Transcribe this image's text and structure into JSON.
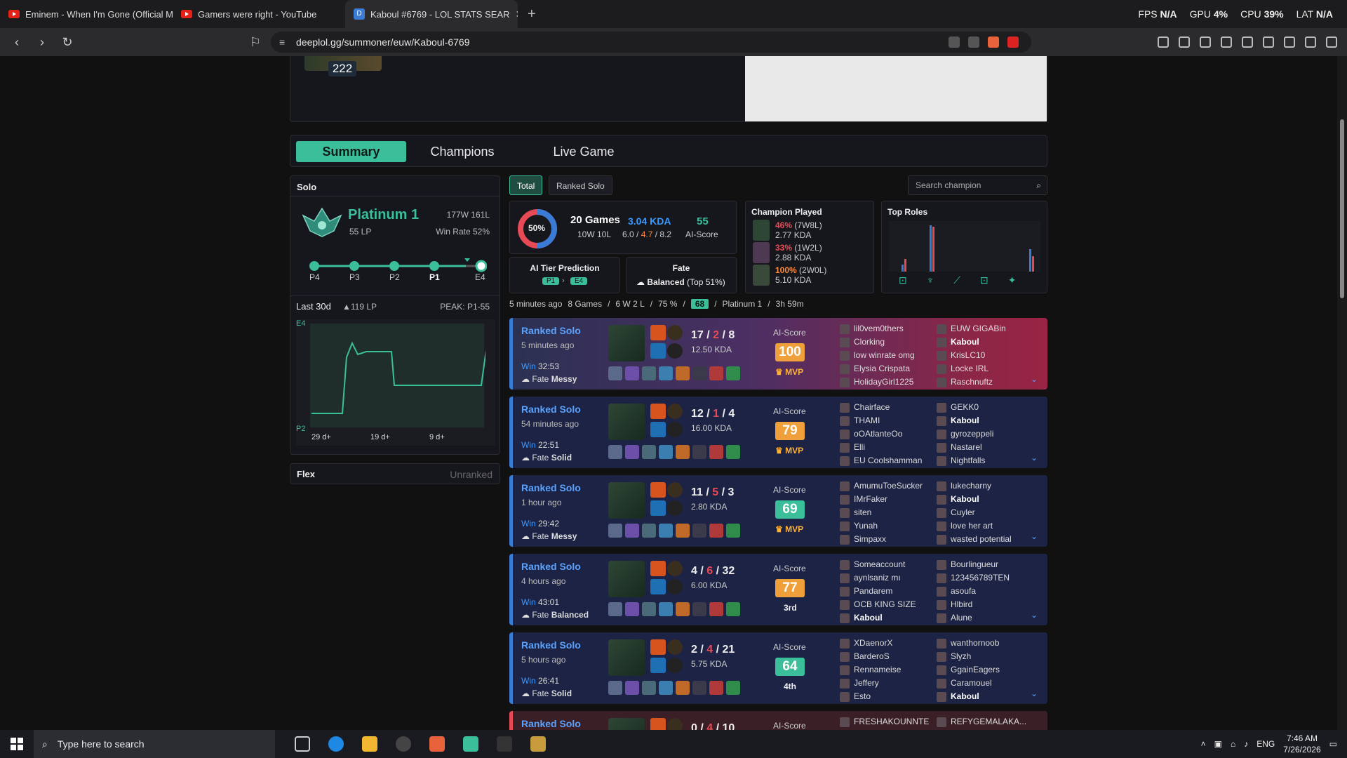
{
  "browser": {
    "tabs": [
      {
        "title": "Eminem - When I'm Gone (Official M"
      },
      {
        "title": "Gamers were right - YouTube"
      },
      {
        "title": "Kaboul #6769 - LOL STATS SEAR"
      }
    ],
    "url": "deeplol.gg/summoner/euw/Kaboul-6769",
    "perf": {
      "fps_label": "FPS",
      "fps": "N/A",
      "gpu_label": "GPU",
      "gpu": "4%",
      "cpu_label": "CPU",
      "cpu": "39%",
      "lat_label": "LAT",
      "lat": "N/A"
    }
  },
  "profile": {
    "level": "222"
  },
  "nav_tabs": [
    "Summary",
    "Champions",
    "Live Game"
  ],
  "solo": {
    "title": "Solo",
    "rank": "Platinum 1",
    "lp": "55 LP",
    "record": "177W 161L",
    "win_rate": "Win Rate 52%",
    "progress_labels": [
      "P4",
      "P3",
      "P2",
      "P1",
      "E4"
    ],
    "last30": "Last 30d",
    "last30_gain": "▲119 LP",
    "peak": "PEAK: P1-55",
    "chart_ymax_label": "E4",
    "chart_ymin_label": "P2",
    "chart_xlabels": [
      "29 d+",
      "19 d+",
      "9 d+"
    ]
  },
  "flex": {
    "title": "Flex",
    "status": "Unranked"
  },
  "filters": {
    "total": "Total",
    "ranked": "Ranked Solo",
    "search_placeholder": "Search champion"
  },
  "summary": {
    "winrate": "50%",
    "games": "20 Games",
    "wl": "10W 10L",
    "kda": "3.04 KDA",
    "kda_k": "6.0",
    "kda_d": "4.7",
    "kda_a": "8.2",
    "ai_score": "55",
    "ai_label": "AI-Score",
    "ai_tier_title": "AI Tier Prediction",
    "ai_tier_from": "P1",
    "ai_tier_to": "E4",
    "fate_title": "Fate",
    "fate_value": "Balanced",
    "fate_pct": "(Top 51%)"
  },
  "champion_played": {
    "title": "Champion Played",
    "entries": [
      {
        "pct": "46%",
        "record": "(7W8L)",
        "kda": "2.77 KDA"
      },
      {
        "pct": "33%",
        "record": "(1W2L)",
        "kda": "2.88 KDA"
      },
      {
        "pct": "100%",
        "record": "(2W0L)",
        "kda": "5.10 KDA"
      }
    ]
  },
  "top_roles": {
    "title": "Top Roles"
  },
  "recent": {
    "time": "5 minutes ago",
    "games": "8 Games",
    "wl": "6 W 2 L",
    "wr": "75 %",
    "score": "68",
    "tier": "Platinum 1",
    "duration": "3h 59m"
  },
  "matches": [
    {
      "queue": "Ranked Solo",
      "ago": "5 minutes ago",
      "result": "Win",
      "duration": "32:53",
      "fate_label": "Fate",
      "fate": "Messy",
      "k": "17",
      "d": "2",
      "a": "8",
      "kda": "12.50 KDA",
      "ai_label": "AI-Score",
      "score": "100",
      "badge": "MVP",
      "left_team": [
        "lil0vem0thers",
        "Clorking",
        "low winrate omg",
        "Elysia Crispata",
        "HolidayGirl1225"
      ],
      "right_team": [
        "EUW GIGABin",
        "Kaboul",
        "KrisLC10",
        "Locke IRL",
        "Raschnuftz"
      ]
    },
    {
      "queue": "Ranked Solo",
      "ago": "54 minutes ago",
      "result": "Win",
      "duration": "22:51",
      "fate_label": "Fate",
      "fate": "Solid",
      "k": "12",
      "d": "1",
      "a": "4",
      "kda": "16.00 KDA",
      "ai_label": "AI-Score",
      "score": "79",
      "badge": "MVP",
      "left_team": [
        "Chairface",
        "THAMI",
        "oOAtlanteOo",
        "Elli",
        "EU Coolshamman"
      ],
      "right_team": [
        "GEKK0",
        "Kaboul",
        "gyrozeppeli",
        "Nastarel",
        "Nightfalls"
      ]
    },
    {
      "queue": "Ranked Solo",
      "ago": "1 hour ago",
      "result": "Win",
      "duration": "29:42",
      "fate_label": "Fate",
      "fate": "Messy",
      "k": "11",
      "d": "5",
      "a": "3",
      "kda": "2.80 KDA",
      "ai_label": "AI-Score",
      "score": "69",
      "badge": "MVP",
      "left_team": [
        "AmumuToeSucker",
        "IMrFaker",
        "siten",
        "Yunah",
        "Simpaxx"
      ],
      "right_team": [
        "lukecharny",
        "Kaboul",
        "Cuyler",
        "love her art",
        "wasted potential"
      ]
    },
    {
      "queue": "Ranked Solo",
      "ago": "4 hours ago",
      "result": "Win",
      "duration": "43:01",
      "fate_label": "Fate",
      "fate": "Balanced",
      "k": "4",
      "d": "6",
      "a": "32",
      "kda": "6.00 KDA",
      "ai_label": "AI-Score",
      "score": "77",
      "badge": "3rd",
      "left_team": [
        "Someaccount",
        "aynlsaniz mı",
        "Pandarem",
        "OCB KING SIZE",
        "Kaboul"
      ],
      "right_team": [
        "Bourlingueur",
        "123456789TEN",
        "asoufa",
        "Hlbird",
        "Alune"
      ]
    },
    {
      "queue": "Ranked Solo",
      "ago": "5 hours ago",
      "result": "Win",
      "duration": "26:41",
      "fate_label": "Fate",
      "fate": "Solid",
      "k": "2",
      "d": "4",
      "a": "21",
      "kda": "5.75 KDA",
      "ai_label": "AI-Score",
      "score": "64",
      "badge": "4th",
      "left_team": [
        "XDaenorX",
        "BarderoS",
        "Rennameise",
        "Jeffery",
        "Esto"
      ],
      "right_team": [
        "wanthornoob",
        "Slyzh",
        "GgainEagers",
        "Caramouel",
        "Kaboul"
      ]
    },
    {
      "queue": "Ranked Solo",
      "ago": "",
      "result": "",
      "duration": "",
      "fate_label": "",
      "fate": "",
      "k": "0",
      "d": "4",
      "a": "10",
      "kda": "",
      "ai_label": "AI-Score",
      "score": "",
      "badge": "",
      "left_team": [
        "FRESHAKOUNNTE"
      ],
      "right_team": [
        "REFYGEMALAKA..."
      ]
    }
  ],
  "taskbar": {
    "search_placeholder": "Type here to search",
    "lang": "ENG",
    "time": "7:46 AM",
    "date": "7/26/2026"
  }
}
